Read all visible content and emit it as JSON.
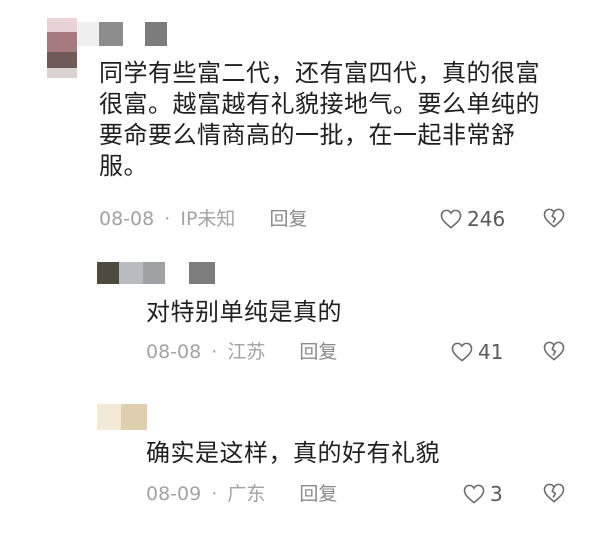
{
  "comments": [
    {
      "text": "同学有些富二代，还有富四代，真的很富\n很富。越富越有礼貌接地气。要么单纯的\n要命要么情商高的一批，在一起非常舒\n服。",
      "date": "08-08",
      "separator": "·",
      "location": "IP未知",
      "reply_label": "回复",
      "like_count": "246"
    },
    {
      "text": "对特别单纯是真的",
      "date": "08-08",
      "separator": "·",
      "location": "江苏",
      "reply_label": "回复",
      "like_count": "41"
    },
    {
      "text": "确实是这样，真的好有礼貌",
      "date": "08-09",
      "separator": "·",
      "location": "广东",
      "reply_label": "回复",
      "like_count": "3"
    }
  ],
  "colors": {
    "text": "#1f1f1f",
    "meta": "#a3a3a3",
    "icon": "#6a6a6a"
  },
  "icons": {
    "like": "heart-outline-icon",
    "dislike": "broken-heart-icon"
  }
}
